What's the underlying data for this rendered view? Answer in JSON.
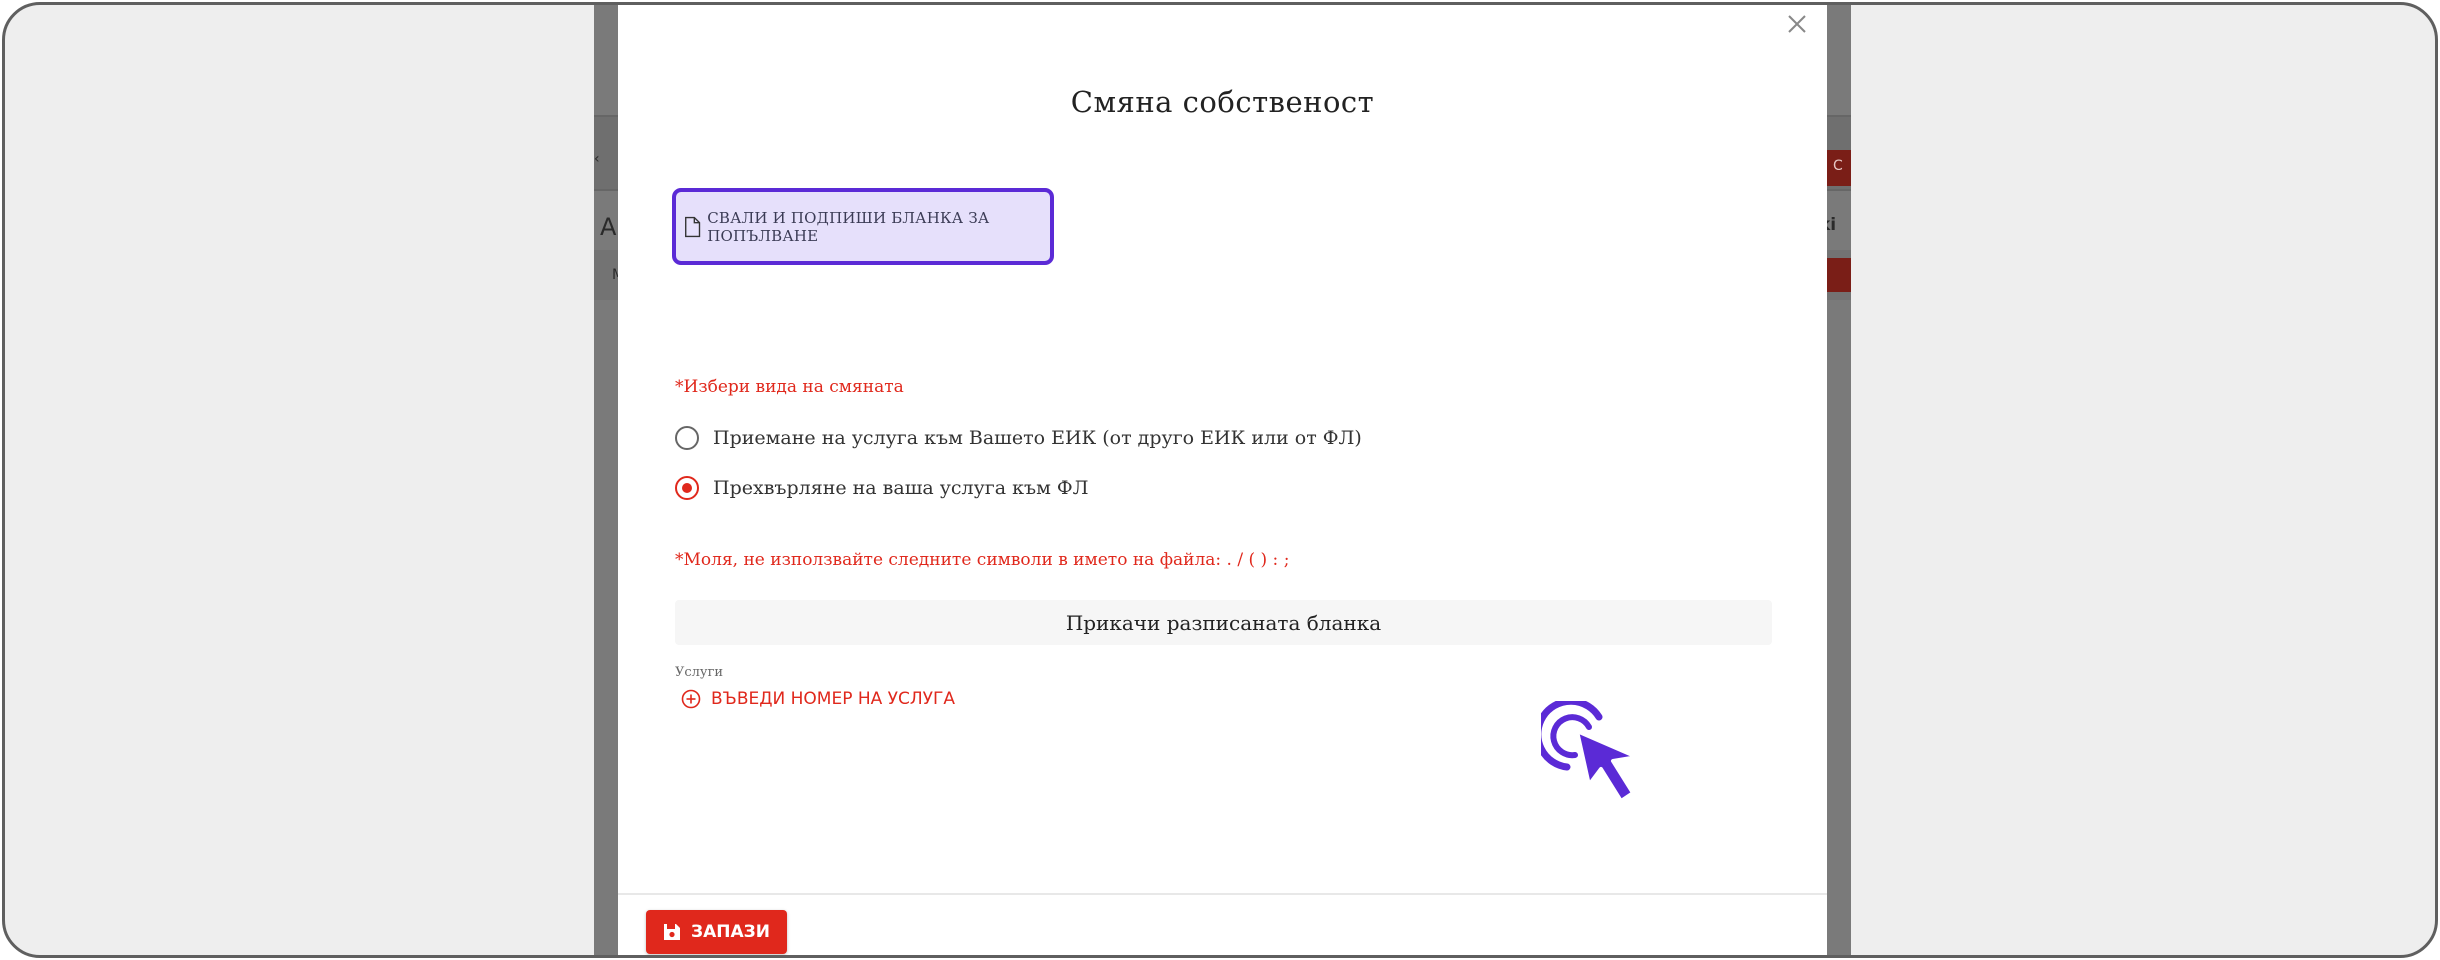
{
  "modal": {
    "title": "Смяна собственост",
    "download_button": "СВАЛИ И ПОДПИШИ БЛАНКА ЗА ПОПЪЛВАНЕ",
    "choose_type_hint": "*Избери вида на смяната",
    "radio_options": [
      {
        "label": "Приемане на услуга към Вашето ЕИК (от друго ЕИК или от ФЛ)",
        "checked": false
      },
      {
        "label": "Прехвърляне на ваша услуга към ФЛ",
        "checked": true
      }
    ],
    "filename_hint": "*Моля, не използвайте следните символи в името на файла: . / ( ) : ;",
    "upload_button": "Прикачи разписаната бланка",
    "services_label": "Услуги",
    "add_service_button": "ВЪВЕДИ НОМЕР НА УСЛУГА",
    "save_button": "ЗАПАЗИ"
  },
  "background": {
    "fragments": [
      "С",
      "ki",
      "А",
      "М"
    ]
  },
  "colors": {
    "accent_red": "#e0281c",
    "highlight_purple": "#5b2ad6",
    "highlight_fill": "#e6e0fb"
  },
  "icons": {
    "close": "close-icon",
    "file": "file-icon",
    "add": "plus-circle-icon",
    "save": "floppy-disk-icon",
    "pointer": "click-pointer-icon"
  }
}
